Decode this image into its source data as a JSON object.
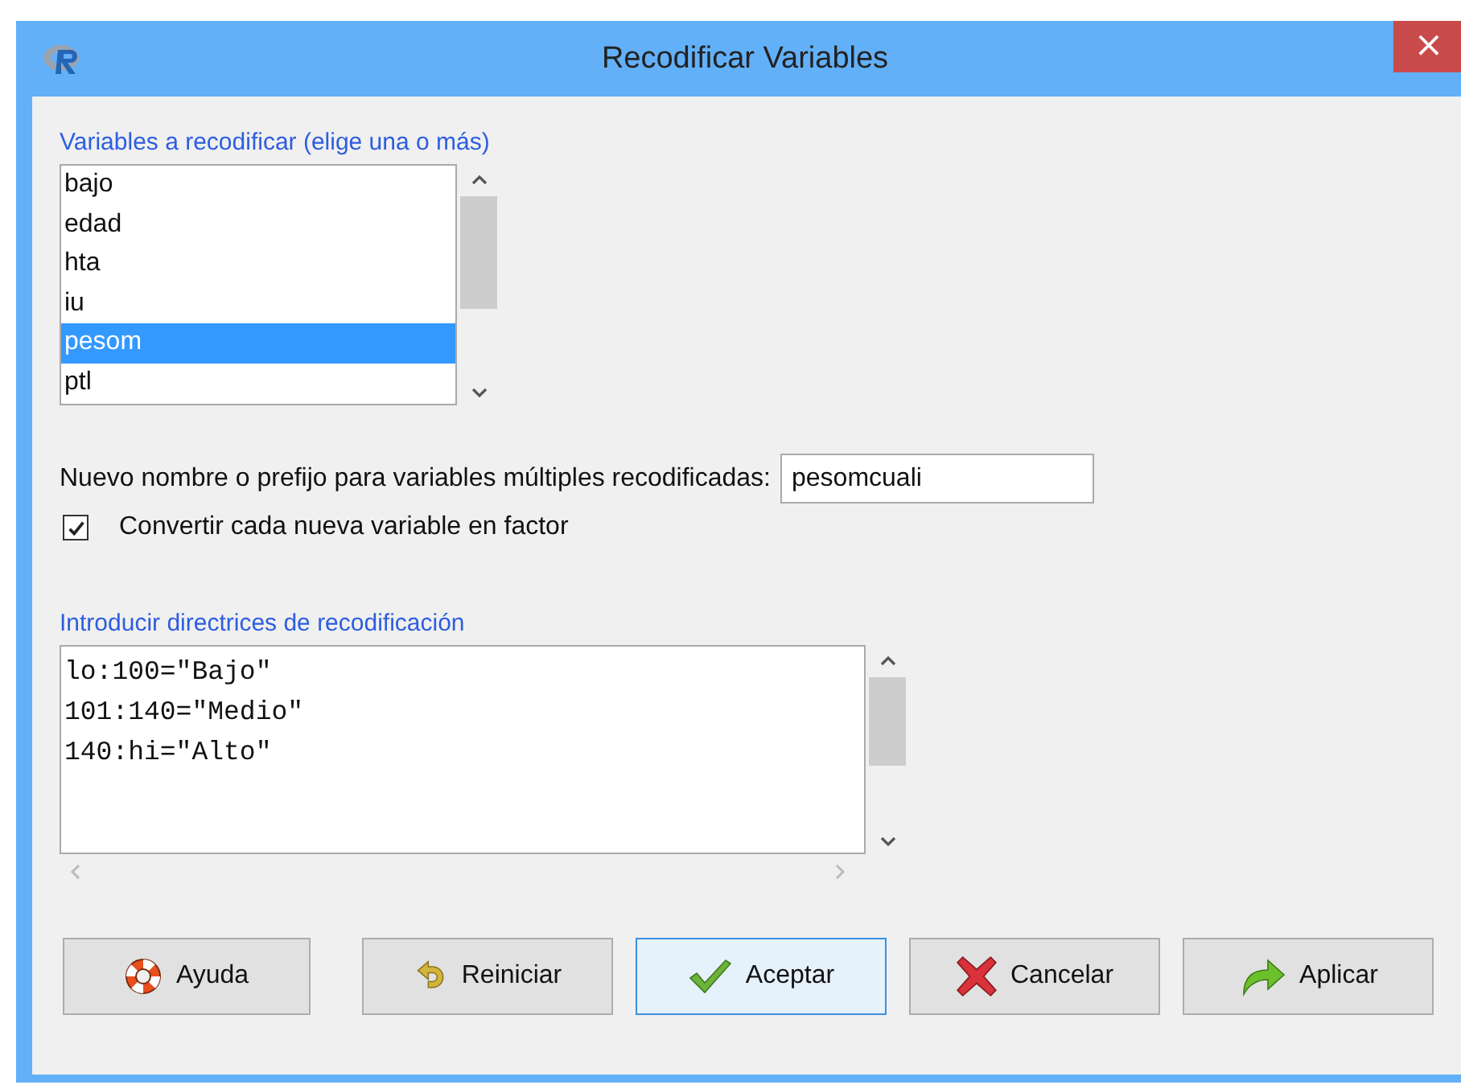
{
  "window": {
    "title": "Recodificar Variables",
    "close_label": "×"
  },
  "variables": {
    "label": "Variables a recodificar (elige una o más)",
    "items": [
      {
        "name": "bajo",
        "selected": false
      },
      {
        "name": "edad",
        "selected": false
      },
      {
        "name": "hta",
        "selected": false
      },
      {
        "name": "iu",
        "selected": false
      },
      {
        "name": "pesom",
        "selected": true
      },
      {
        "name": "ptl",
        "selected": false
      }
    ]
  },
  "new_name": {
    "label": "Nuevo nombre o prefijo para variables múltiples recodificadas:",
    "value": "pesomcuali"
  },
  "factor": {
    "label": "Convertir cada nueva variable en factor",
    "checked": true
  },
  "directives": {
    "label": "Introducir directrices de recodificación",
    "lines": [
      "lo:100=\"Bajo\"",
      "101:140=\"Medio\"",
      "140:hi=\"Alto\""
    ]
  },
  "buttons": [
    {
      "kind": "help",
      "label": "Ayuda",
      "default": false
    },
    {
      "kind": "reset",
      "label": "Reiniciar",
      "default": false
    },
    {
      "kind": "ok",
      "label": "Aceptar",
      "default": true
    },
    {
      "kind": "cancel",
      "label": "Cancelar",
      "default": false
    },
    {
      "kind": "apply",
      "label": "Aplicar",
      "default": false
    }
  ]
}
